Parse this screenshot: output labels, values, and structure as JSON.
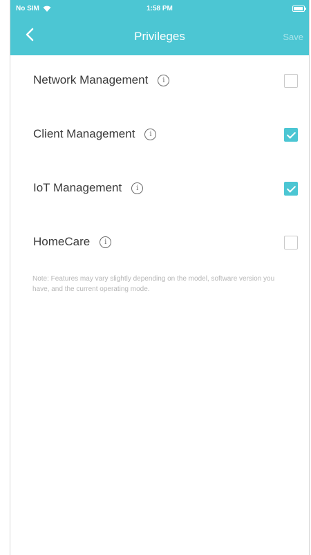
{
  "status_bar": {
    "carrier": "No SIM",
    "time": "1:58 PM",
    "battery_level": 0.9,
    "wifi_icon": "wifi-icon"
  },
  "header": {
    "back_icon": "chevron-left-icon",
    "title": "Privileges",
    "save_label": "Save"
  },
  "privileges": [
    {
      "label": "Network Management",
      "checked": false
    },
    {
      "label": "Client Management",
      "checked": true
    },
    {
      "label": "IoT Management",
      "checked": true
    },
    {
      "label": "HomeCare",
      "checked": false
    }
  ],
  "info_icon": "info-circle-icon",
  "note": "Note: Features may vary slightly depending on the model, software version you have, and the current operating mode.",
  "colors": {
    "accent": "#4cc6d3",
    "text": "#3a3a3a",
    "note_text": "#b6b6b6"
  }
}
